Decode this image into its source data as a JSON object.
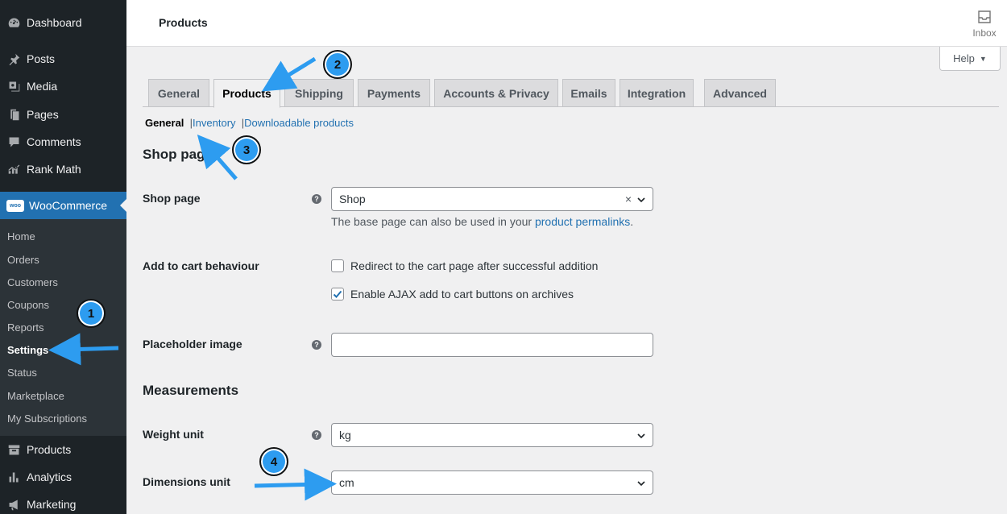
{
  "sidebar": {
    "menu": [
      {
        "label": "Dashboard",
        "icon": "dashboard-icon"
      },
      {
        "label": "Posts",
        "icon": "pin-icon"
      },
      {
        "label": "Media",
        "icon": "media-icon"
      },
      {
        "label": "Pages",
        "icon": "pages-icon"
      },
      {
        "label": "Comments",
        "icon": "comment-icon"
      },
      {
        "label": "Rank Math",
        "icon": "chart-icon"
      },
      {
        "label": "WooCommerce",
        "icon": "woo-icon",
        "badge": "woo"
      }
    ],
    "submenu": [
      "Home",
      "Orders",
      "Customers",
      "Coupons",
      "Reports",
      "Settings",
      "Status",
      "Marketplace",
      "My Subscriptions"
    ],
    "bottom_menu": [
      {
        "label": "Products",
        "icon": "archive-icon"
      },
      {
        "label": "Analytics",
        "icon": "bar-chart-icon"
      },
      {
        "label": "Marketing",
        "icon": "megaphone-icon"
      }
    ]
  },
  "header": {
    "title": "Products",
    "inbox_label": "Inbox",
    "help_label": "Help"
  },
  "tabs": [
    "General",
    "Products",
    "Shipping",
    "Payments",
    "Accounts & Privacy",
    "Emails",
    "Integration",
    "Advanced"
  ],
  "subtabs": {
    "current": "General",
    "links": [
      "Inventory",
      "Downloadable products"
    ]
  },
  "shop_section": {
    "heading": "Shop pages",
    "shop_page_label": "Shop page",
    "shop_page_value": "Shop",
    "shop_page_clear": "×",
    "desc_prefix": "The base page can also be used in your ",
    "desc_link": "product permalinks",
    "desc_suffix": ".",
    "cart_label": "Add to cart behaviour",
    "cart_opt1": "Redirect to the cart page after successful addition",
    "cart_opt1_checked": false,
    "cart_opt2": "Enable AJAX add to cart buttons on archives",
    "cart_opt2_checked": true,
    "placeholder_label": "Placeholder image",
    "placeholder_value": "",
    "help_tip": "?"
  },
  "measurements": {
    "heading": "Measurements",
    "weight_label": "Weight unit",
    "weight_value": "kg",
    "dimensions_label": "Dimensions unit",
    "dimensions_value": "cm"
  },
  "annotations": [
    "1",
    "2",
    "3",
    "4"
  ],
  "colors": {
    "sidebar_bg": "#1d2327",
    "accent": "#2271b1",
    "annotation": "#2d9cf0"
  }
}
